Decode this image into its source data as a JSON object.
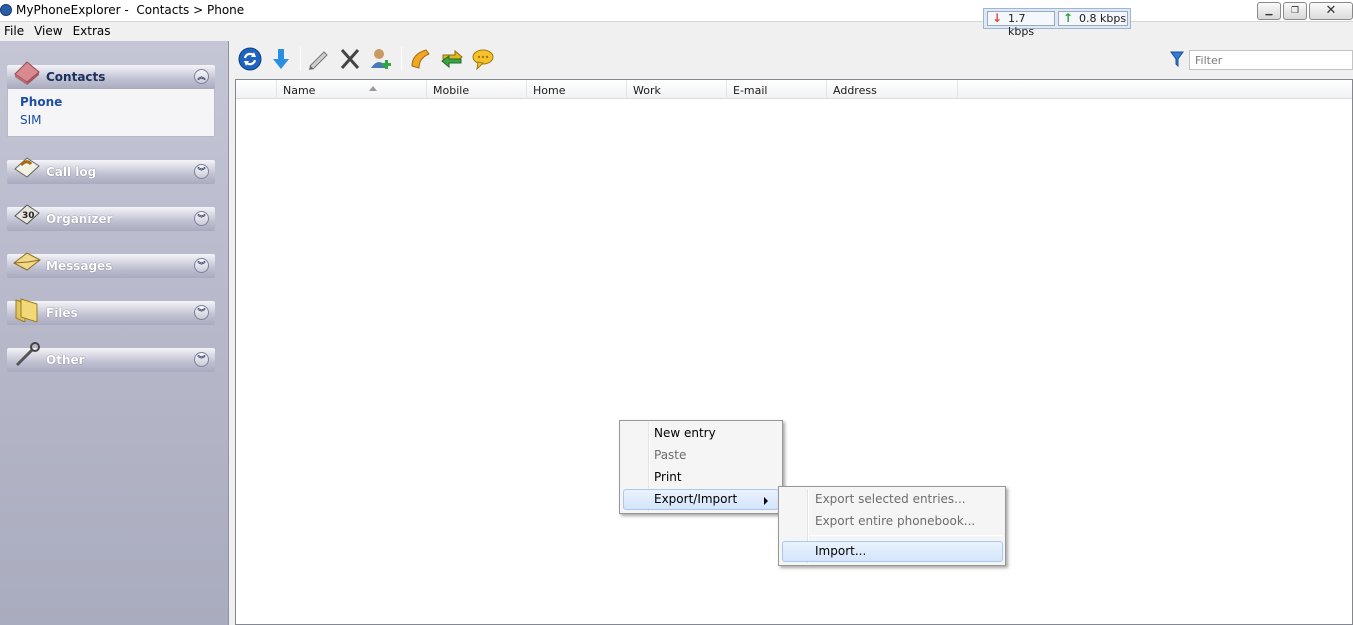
{
  "window": {
    "app_name": "MyPhoneExplorer",
    "title": "MyPhoneExplorer -  Contacts > Phone",
    "download_speed": "1.7 kbps",
    "upload_speed": "0.8 kbps"
  },
  "menubar": {
    "items": [
      "File",
      "View",
      "Extras"
    ]
  },
  "sidebar": {
    "panels": [
      {
        "label": "Contacts",
        "icon": "contacts-book-icon",
        "expanded": true,
        "items": [
          "Phone",
          "SIM"
        ],
        "active_item": "Phone"
      },
      {
        "label": "Call log",
        "icon": "phone-book-icon",
        "expanded": false
      },
      {
        "label": "Organizer",
        "icon": "organizer-calendar-icon",
        "expanded": false
      },
      {
        "label": "Messages",
        "icon": "envelope-icon",
        "expanded": false
      },
      {
        "label": "Files",
        "icon": "folder-icon",
        "expanded": false
      },
      {
        "label": "Other",
        "icon": "wrench-icon",
        "expanded": false
      }
    ]
  },
  "toolbar": {
    "buttons": [
      "refresh-icon",
      "download-arrow-icon",
      "edit-pen-icon",
      "delete-x-icon",
      "add-contact-icon",
      "call-phone-icon",
      "sync-transfer-icon",
      "sms-bubble-icon"
    ],
    "filter_placeholder": "Filter"
  },
  "list": {
    "columns": [
      "",
      "Name",
      "Mobile",
      "Home",
      "Work",
      "E-mail",
      "Address"
    ],
    "sorted_column": "Name",
    "rows": []
  },
  "context_menu": {
    "items": [
      {
        "label": "New entry",
        "enabled": true
      },
      {
        "label": "Paste",
        "enabled": false
      },
      {
        "label": "Print",
        "enabled": true
      },
      {
        "label": "Export/Import",
        "enabled": true,
        "has_submenu": true,
        "highlighted": true
      }
    ],
    "submenu": [
      {
        "label": "Export selected entries...",
        "enabled": false
      },
      {
        "label": "Export entire phonebook...",
        "enabled": false
      },
      {
        "label": "Import...",
        "enabled": true,
        "highlighted": true
      }
    ]
  },
  "colors": {
    "sidebar_bg": "#b4b6c8",
    "link_blue": "#1d4ea0",
    "highlight_border": "#a8c8f0"
  }
}
